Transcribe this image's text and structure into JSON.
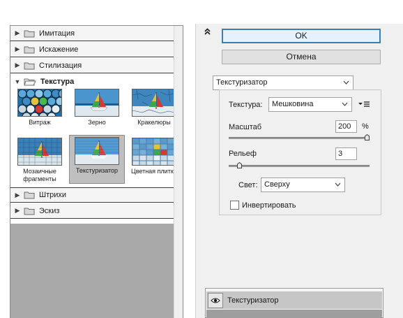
{
  "categories": {
    "imitation": "Имитация",
    "distortion": "Искажение",
    "stylization": "Стилизация",
    "texture": "Текстура",
    "strokes": "Штрихи",
    "sketch": "Эскиз"
  },
  "thumbnails": [
    "Витраж",
    "Зерно",
    "Кракелюры",
    "Мозаичные фрагменты",
    "Текстуризатор",
    "Цветная плитка"
  ],
  "buttons": {
    "ok": "OK",
    "cancel": "Отмена"
  },
  "filter_select": "Текстуризатор",
  "settings": {
    "texture_label": "Текстура:",
    "texture_value": "Мешковина",
    "scale_label": "Масштаб",
    "scale_value": "200",
    "scale_unit": "%",
    "scale_level_percent": 100,
    "relief_label": "Рельеф",
    "relief_value": "3",
    "relief_level_percent": 6,
    "light_label": "Свет:",
    "light_value": "Сверху",
    "invert_label": "Инвертировать",
    "invert_checked": false
  },
  "effect_layer": {
    "name": "Текстуризатор",
    "visible": true
  },
  "icons": [
    "collapse-icon",
    "folder-icon",
    "arrow-icon",
    "menu-icon",
    "eye-icon",
    "chevron-down-icon"
  ],
  "colors": {
    "ok_border": "#3c7fb1",
    "selected_thumb_bg": "#bfbfbf",
    "panel_bg": "#f0f0f0"
  }
}
